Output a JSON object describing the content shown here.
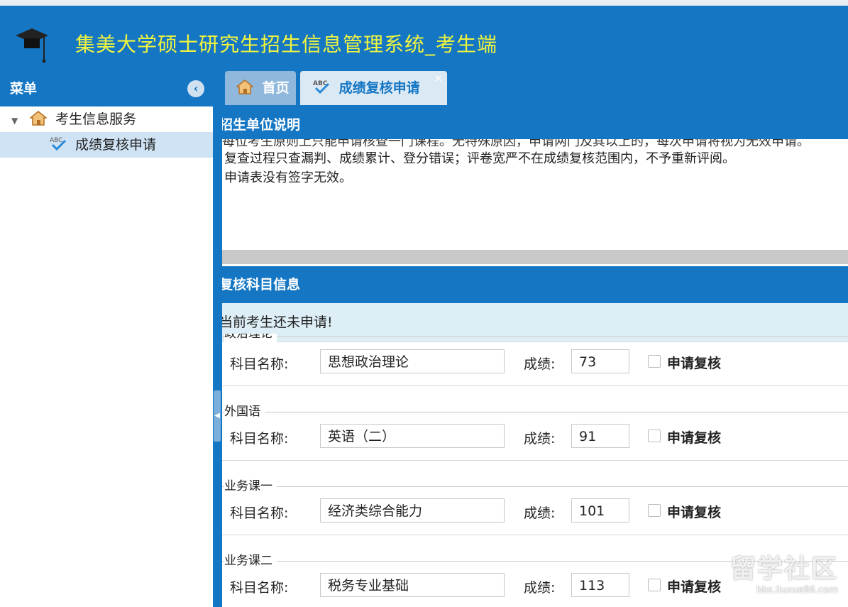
{
  "header": {
    "title": "集美大学硕士研究生招生信息管理系统_考生端"
  },
  "sidebar": {
    "title": "菜单",
    "collapse_icon": "chevron-left-icon",
    "tree": [
      {
        "label": "考生信息服务",
        "icon": "home-icon",
        "expanded": true
      },
      {
        "label": "成绩复核申请",
        "icon": "abc-check-icon",
        "selected": true
      }
    ]
  },
  "tabs": [
    {
      "label": "首页",
      "icon": "home-icon"
    },
    {
      "label": "成绩复核申请",
      "icon": "abc-check-icon",
      "active": true,
      "close": "×"
    }
  ],
  "notes_panel": {
    "title": "招生单位说明",
    "lines": [
      "每位考生原则上只能申请核查一门课程。无特殊原因，申请两门及其以上的，每次申请将视为无效申请。",
      "复查过程只查漏判、成绩累计、登分错误；评卷宽严不在成绩复核范围内，不予重新评阅。",
      "申请表没有签字无效。"
    ]
  },
  "subjects_panel": {
    "title": "复核科目信息",
    "notice": "当前考生还未申请!",
    "name_label": "科目名称:",
    "score_label": "成绩:",
    "checkbox_label": "申请复核",
    "subjects": [
      {
        "group": "政治理论",
        "name": "思想政治理论",
        "score": "73"
      },
      {
        "group": "外国语",
        "name": "英语（二）",
        "score": "91"
      },
      {
        "group": "业务课一",
        "name": "经济类综合能力",
        "score": "101"
      },
      {
        "group": "业务课二",
        "name": "税务专业基础",
        "score": "113"
      }
    ]
  },
  "watermark": {
    "main": "留学社区",
    "url": "bbs.liuxue86.com"
  },
  "colors": {
    "primary": "#1576c4",
    "title_yellow": "#f1f53e",
    "notice_bg": "#ddeef6",
    "tab_active_bg": "#dbe9f5"
  }
}
